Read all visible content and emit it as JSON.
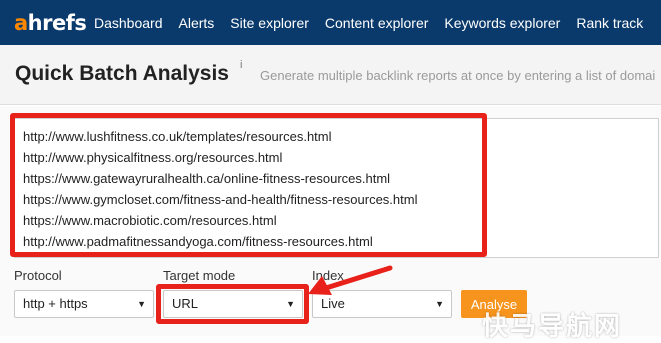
{
  "nav": {
    "logo_a": "a",
    "logo_rest": "hrefs",
    "items": [
      {
        "label": "Dashboard"
      },
      {
        "label": "Alerts"
      },
      {
        "label": "Site explorer"
      },
      {
        "label": "Content explorer"
      },
      {
        "label": "Keywords explorer"
      },
      {
        "label": "Rank track"
      }
    ]
  },
  "header": {
    "title": "Quick Batch Analysis",
    "info_mark": "i",
    "subtitle": "Generate multiple backlink reports at once by entering a list of domai"
  },
  "urls": [
    "http://www.lushfitness.co.uk/templates/resources.html",
    "http://www.physicalfitness.org/resources.html",
    "https://www.gatewayruralhealth.ca/online-fitness-resources.html",
    "https://www.gymcloset.com/fitness-and-health/fitness-resources.html",
    "https://www.macrobiotic.com/resources.html",
    "http://www.padmafitnessandyoga.com/fitness-resources.html"
  ],
  "form": {
    "protocol_label": "Protocol",
    "protocol_value": "http + https",
    "target_mode_label": "Target mode",
    "target_mode_value": "URL",
    "index_label": "Index",
    "index_value": "Live",
    "analyse_label": "Analyse",
    "caret": "▼"
  },
  "watermark": "快马导航网",
  "colors": {
    "nav_bg": "#0a3a6b",
    "brand_orange": "#ff8800",
    "annotation_red": "#e8211b",
    "button_orange": "#f7941d"
  }
}
